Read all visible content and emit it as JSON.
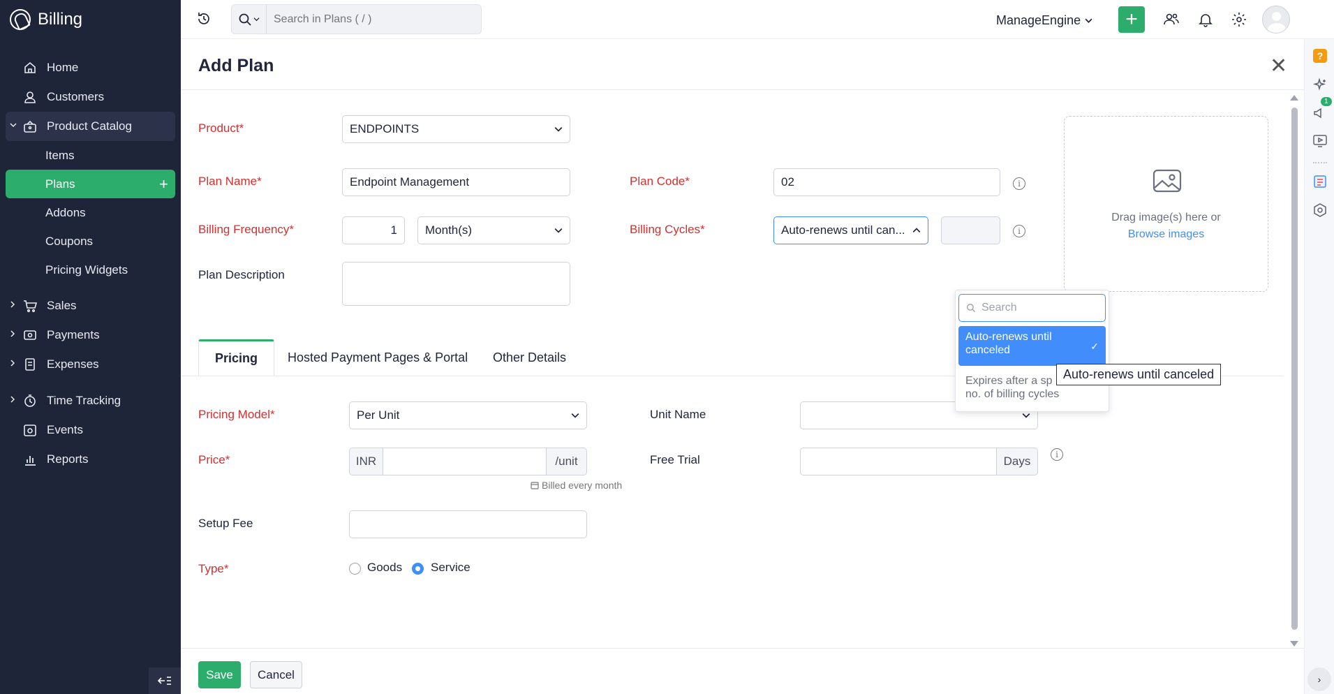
{
  "app": {
    "name": "Billing"
  },
  "sidebar": {
    "items": [
      {
        "label": "Home",
        "icon": "home-icon"
      },
      {
        "label": "Customers",
        "icon": "user-icon"
      },
      {
        "label": "Product Catalog",
        "icon": "basket-icon"
      },
      {
        "label": "Sales",
        "icon": "cart-icon"
      },
      {
        "label": "Payments",
        "icon": "payment-icon"
      },
      {
        "label": "Expenses",
        "icon": "receipt-icon"
      },
      {
        "label": "Time Tracking",
        "icon": "stopwatch-icon"
      },
      {
        "label": "Events",
        "icon": "events-icon"
      },
      {
        "label": "Reports",
        "icon": "bar-chart-icon"
      }
    ],
    "catalog_sub": [
      "Items",
      "Plans",
      "Addons",
      "Coupons",
      "Pricing Widgets"
    ]
  },
  "topbar": {
    "search_placeholder": "Search in Plans ( / )",
    "org_name": "ManageEngine"
  },
  "rail": {
    "notification_count": "1"
  },
  "form": {
    "title": "Add Plan",
    "product_label": "Product*",
    "product_value": "ENDPOINTS",
    "plan_name_label": "Plan Name*",
    "plan_name_value": "Endpoint Management",
    "plan_code_label": "Plan Code*",
    "plan_code_value": "02",
    "billing_frequency_label": "Billing Frequency*",
    "billing_frequency_count": "1",
    "billing_frequency_unit": "Month(s)",
    "billing_cycles_label": "Billing Cycles*",
    "billing_cycles_value": "Auto-renews until can...",
    "plan_description_label": "Plan Description",
    "image_drop_text": "Drag image(s) here or",
    "browse_images": "Browse images"
  },
  "dropdown": {
    "search_placeholder": "Search",
    "options": [
      "Auto-renews until canceled",
      "Expires after a specified no. of billing cycles"
    ],
    "option_selected_line1": "Auto-renews until",
    "option_selected_line2": "canceled",
    "option_other_line1": "Expires after a sp",
    "option_other_line2": "no. of billing cycles",
    "tooltip": "Auto-renews until canceled"
  },
  "tabs": [
    "Pricing",
    "Hosted Payment Pages & Portal",
    "Other Details"
  ],
  "pricing": {
    "pricing_model_label": "Pricing Model*",
    "pricing_model_value": "Per Unit",
    "unit_name_label": "Unit Name",
    "price_label": "Price*",
    "currency": "INR",
    "per_unit": "/unit",
    "billed_hint": "Billed every month",
    "free_trial_label": "Free Trial",
    "free_trial_unit": "Days",
    "setup_fee_label": "Setup Fee",
    "type_label": "Type*",
    "type_goods": "Goods",
    "type_service": "Service",
    "type_selected": "Service"
  },
  "footer": {
    "save": "Save",
    "cancel": "Cancel"
  },
  "colors": {
    "sidebar": "#1f2539",
    "accent_green": "#2dad6b",
    "required_red": "#d3302f",
    "link_blue": "#408dfb"
  }
}
